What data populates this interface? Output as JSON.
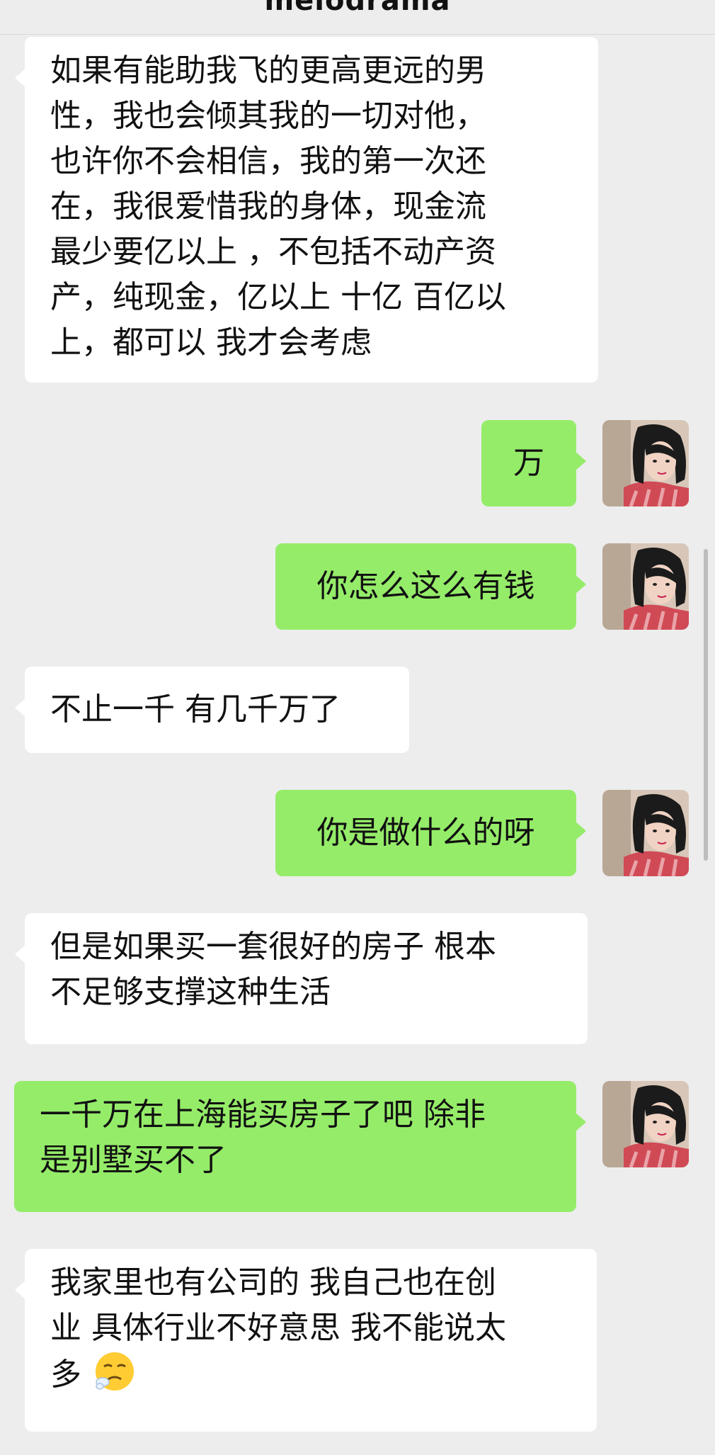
{
  "header": {
    "title": "melodrama"
  },
  "messages": [
    {
      "id": "m1",
      "side": "incoming",
      "lines": [
        "如果有能助我飞的更高更远的男",
        "性，我也会倾其我的一切对他，",
        "也许你不会相信，我的第一次还",
        "在，我很爱惜我的身体，现金流",
        "最少要亿以上 ，不包括不动产资",
        "产，纯现金，亿以上 十亿 百亿以",
        "上，都可以 我才会考虑"
      ]
    },
    {
      "id": "m2",
      "side": "outgoing",
      "text": "万"
    },
    {
      "id": "m3",
      "side": "outgoing",
      "text": "你怎么这么有钱"
    },
    {
      "id": "m4",
      "side": "incoming",
      "text": "不止一千 有几千万了"
    },
    {
      "id": "m5",
      "side": "outgoing",
      "text": "你是做什么的呀"
    },
    {
      "id": "m6",
      "side": "incoming",
      "lines": [
        "但是如果买一套很好的房子 根本",
        "不足够支撑这种生活"
      ]
    },
    {
      "id": "m7",
      "side": "outgoing",
      "lines": [
        "一千万在上海能买房子了吧 除非",
        "是别墅买不了"
      ]
    },
    {
      "id": "m8",
      "side": "incoming",
      "lines": [
        "我家里也有公司的 我自己也在创",
        "业 具体行业不好意思 我不能说太",
        "多"
      ],
      "emoji": "sweat-sigh-emoji"
    }
  ],
  "colors": {
    "background": "#ededed",
    "incoming_bubble": "#ffffff",
    "outgoing_bubble": "#95ec69",
    "text": "#111111"
  }
}
